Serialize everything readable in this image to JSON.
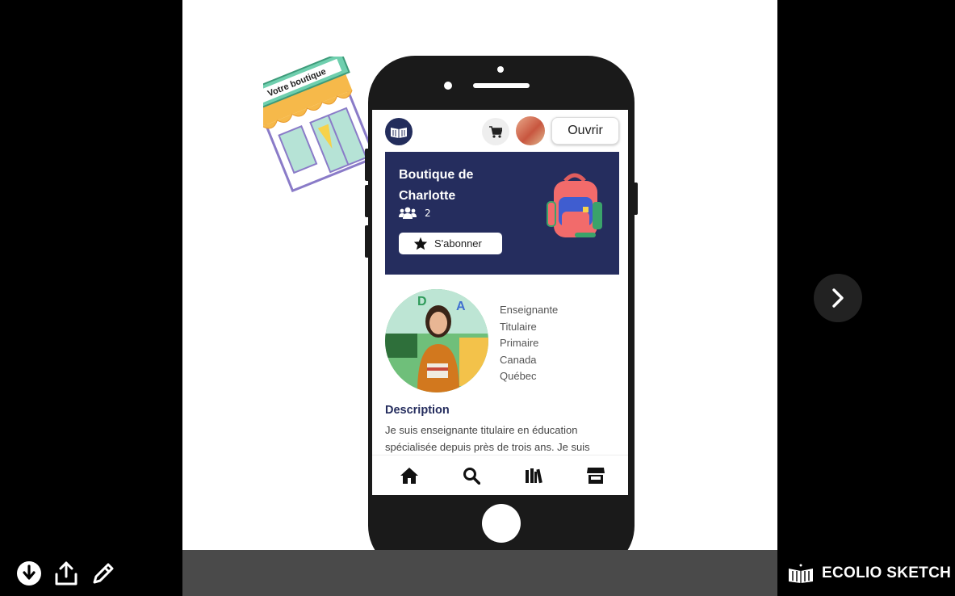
{
  "sticker": {
    "label": "Votre boutique"
  },
  "header": {
    "open_label": "Ouvrir"
  },
  "banner": {
    "title": "Boutique de Charlotte",
    "member_count": "2",
    "subscribe_label": "S'abonner"
  },
  "profile": {
    "details": [
      "Enseignante",
      "Titulaire",
      "Primaire",
      "Canada",
      "Québec"
    ]
  },
  "description": {
    "title": "Description",
    "text": "Je suis enseignante titulaire en éducation spécialisée depuis près de trois ans. Je suis"
  },
  "bottom_nav": {
    "icons": [
      "home-icon",
      "search-icon",
      "library-icon",
      "store-icon"
    ]
  },
  "footer": {
    "brand": "ECOLIO SKETCH",
    "icons": [
      "download-icon",
      "share-icon",
      "edit-icon"
    ]
  },
  "colors": {
    "navy": "#252d5e",
    "footer_bar": "#4a4a4a",
    "phone_body": "#1a1a1a"
  }
}
